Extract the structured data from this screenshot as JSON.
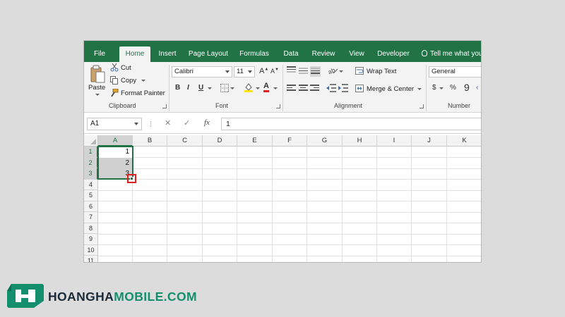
{
  "tabs": [
    "File",
    "Home",
    "Insert",
    "Page Layout",
    "Formulas",
    "Data",
    "Review",
    "View",
    "Developer"
  ],
  "tell_me": "Tell me what you",
  "clipboard": {
    "paste": "Paste",
    "cut": "Cut",
    "copy": "Copy",
    "format_painter": "Format Painter",
    "label": "Clipboard"
  },
  "font": {
    "name": "Calibri",
    "size": "11",
    "grow": "A",
    "shrink": "A",
    "bold": "B",
    "italic": "I",
    "underline": "U",
    "color_glyph": "A",
    "label": "Font",
    "highlight_color": "#ffe500",
    "font_color": "#e0201f"
  },
  "alignment": {
    "wrap_text": "Wrap Text",
    "merge_center": "Merge & Center",
    "label": "Alignment"
  },
  "number": {
    "format": "General",
    "currency": "$",
    "percent": "%",
    "comma": "9",
    "label": "Number"
  },
  "formula_bar": {
    "name_box": "A1",
    "cancel": "✕",
    "enter": "✓",
    "fx": "fx",
    "value": "1"
  },
  "grid": {
    "columns": [
      "A",
      "B",
      "C",
      "D",
      "E",
      "F",
      "G",
      "H",
      "I",
      "J",
      "K"
    ],
    "rows": [
      "1",
      "2",
      "3",
      "4",
      "5",
      "6",
      "7",
      "8",
      "9",
      "10",
      "11"
    ],
    "cells": {
      "A1": "1",
      "A2": "2",
      "A3": "3"
    }
  },
  "colors": {
    "accent": "#217346",
    "highlight": "#e0201f"
  },
  "logo": {
    "part1": "HOANGHA",
    "part2": "MOBILE.COM",
    "color_dark": "#1b2a38",
    "color_green": "#148f6e"
  }
}
